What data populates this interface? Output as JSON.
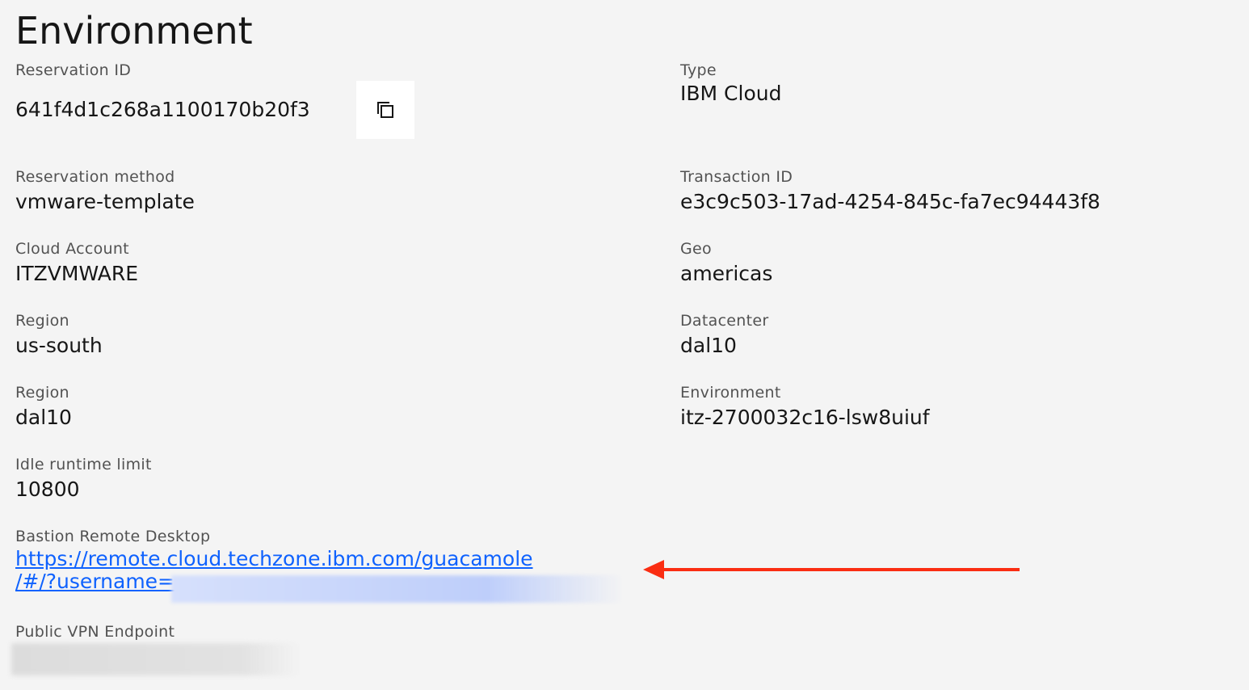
{
  "page": {
    "title": "Environment"
  },
  "left_fields": {
    "reservation_id": {
      "label": "Reservation ID",
      "value": "641f4d1c268a1100170b20f3"
    },
    "reservation_method": {
      "label": "Reservation method",
      "value": "vmware-template"
    },
    "cloud_account": {
      "label": "Cloud Account",
      "value": "ITZVMWARE"
    },
    "region": {
      "label": "Region",
      "value": "us-south"
    },
    "region2": {
      "label": "Region",
      "value": "dal10"
    },
    "idle_runtime_limit": {
      "label": "Idle runtime limit",
      "value": "10800"
    },
    "bastion_remote_desktop": {
      "label": "Bastion Remote Desktop",
      "line1": "https://remote.cloud.techzone.ibm.com/guacamole",
      "line2": "/#/?username="
    },
    "public_vpn_endpoint": {
      "label": "Public VPN Endpoint"
    }
  },
  "right_fields": {
    "type": {
      "label": "Type",
      "value": "IBM Cloud"
    },
    "transaction_id": {
      "label": "Transaction ID",
      "value": "e3c9c503-17ad-4254-845c-fa7ec94443f8"
    },
    "geo": {
      "label": "Geo",
      "value": "americas"
    },
    "datacenter": {
      "label": "Datacenter",
      "value": "dal10"
    },
    "environment": {
      "label": "Environment",
      "value": "itz-2700032c16-lsw8uiuf"
    }
  },
  "icons": {
    "copy": "copy-icon",
    "arrow": "red-arrow-left-icon"
  },
  "colors": {
    "background": "#f4f4f4",
    "text": "#161616",
    "label": "#525252",
    "link": "#0f62fe",
    "arrow": "#fa2d12",
    "button_bg": "#ffffff"
  }
}
